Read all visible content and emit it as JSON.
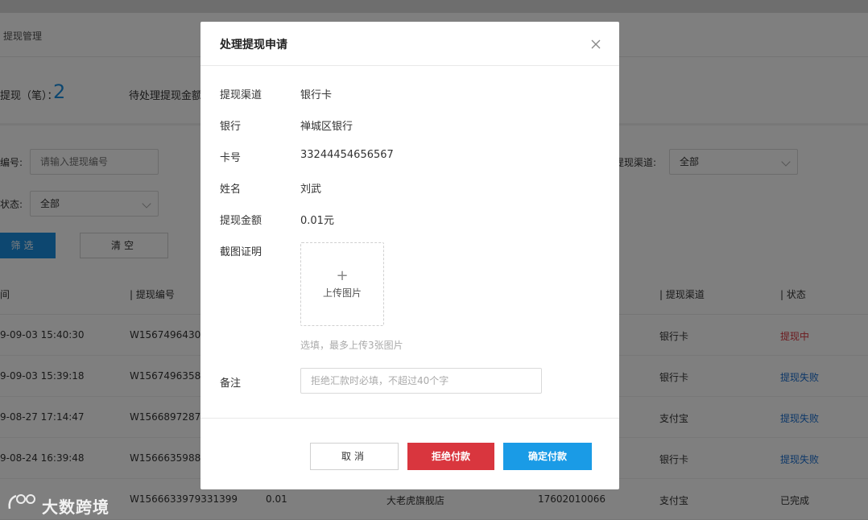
{
  "breadcrumb": {
    "current": "提现管理"
  },
  "stats": {
    "count_label": "提现（笔）：",
    "count_value": "2",
    "pending_label": "待处理提现金额"
  },
  "filters": {
    "number_label": "编号:",
    "number_placeholder": "请输入提现编号",
    "status_label": "状态:",
    "status_value": "全部",
    "channel_label": "提现渠道:",
    "channel_value": "全部",
    "filter_button": "筛选",
    "clear_button": "清空"
  },
  "table": {
    "headers": {
      "time": "间",
      "number": "| 提现编号",
      "channel": "| 提现渠道",
      "status": "| 状态"
    },
    "rows": [
      {
        "time": "9-09-03 15:40:30",
        "number": "W1567496430",
        "channel": "银行卡",
        "status": "提现中"
      },
      {
        "time": "9-09-03 15:39:18",
        "number": "W1567496358",
        "channel": "银行卡",
        "status": "提现失败"
      },
      {
        "time": "9-08-27 17:14:47",
        "number": "W1566897287",
        "channel": "支付宝",
        "status": "提现失败"
      },
      {
        "time": "9-08-24 16:39:48",
        "number": "W1566635988",
        "channel": "银行卡",
        "status": "提现失败"
      },
      {
        "time": "",
        "number": "W1566633979331399",
        "amount": "0.01",
        "shop": "大老虎旗舰店",
        "phone": "17602010066",
        "channel": "支付宝",
        "status": "已完成"
      }
    ]
  },
  "modal": {
    "title": "处理提现申请",
    "fields": {
      "channel_label": "提现渠道",
      "channel_value": "银行卡",
      "bank_label": "银行",
      "bank_value": "禅城区银行",
      "card_label": "卡号",
      "card_value": "33244454656567",
      "name_label": "姓名",
      "name_value": "刘武",
      "amount_label": "提现金额",
      "amount_value": "0.01元",
      "proof_label": "截图证明"
    },
    "upload": {
      "plus": "+",
      "label": "上传图片",
      "hint": "选填，最多上传3张图片"
    },
    "remark": {
      "label": "备注",
      "placeholder": "拒绝汇款时必填，不超过40个字"
    },
    "buttons": {
      "cancel": "取消",
      "reject": "拒绝付款",
      "confirm": "确定付款"
    }
  },
  "watermark": {
    "text": "大数跨境"
  },
  "colors": {
    "primary": "#1a8fe0",
    "danger": "#d9363e",
    "confirm": "#1a9be6"
  }
}
